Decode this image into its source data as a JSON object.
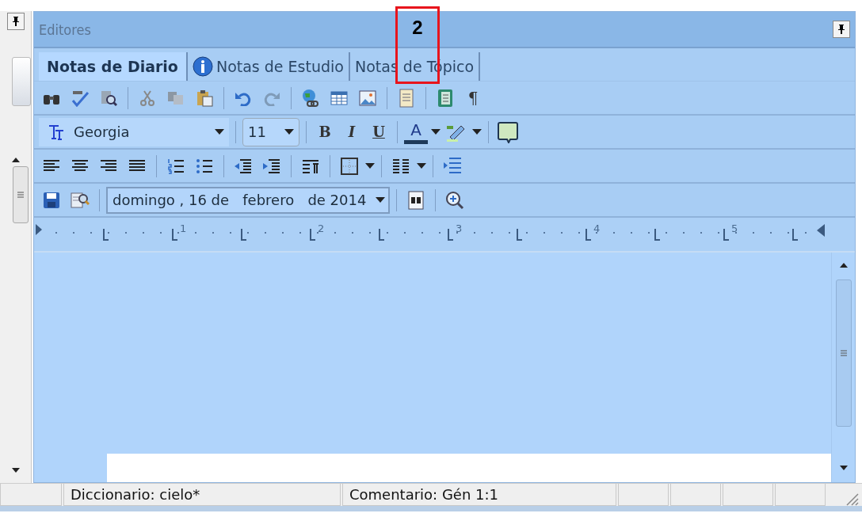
{
  "panel": {
    "title": "Editores"
  },
  "tabs": [
    {
      "label": "Notas de Diario",
      "selected": true,
      "info_icon": false
    },
    {
      "label": "Notas de Estudio",
      "selected": false,
      "info_icon": true
    },
    {
      "label": "Notas de Tópico",
      "selected": false,
      "info_icon": false
    }
  ],
  "standard_toolbar": {
    "paragraph_mark": "¶"
  },
  "format_toolbar": {
    "font": "Georgia",
    "size": "11",
    "bold": "B",
    "italic": "I",
    "underline": "U",
    "font_color": "A"
  },
  "date_toolbar": {
    "date": "domingo , 16 de   febrero   de 2014"
  },
  "ruler": {
    "numbers": [
      "1",
      "2",
      "3",
      "4",
      "5"
    ]
  },
  "status_bar": {
    "cells": [
      "",
      "Diccionario: cielo*",
      "Comentario: Gén 1:1",
      "",
      "",
      "",
      ""
    ]
  },
  "callout": {
    "label": "2"
  }
}
